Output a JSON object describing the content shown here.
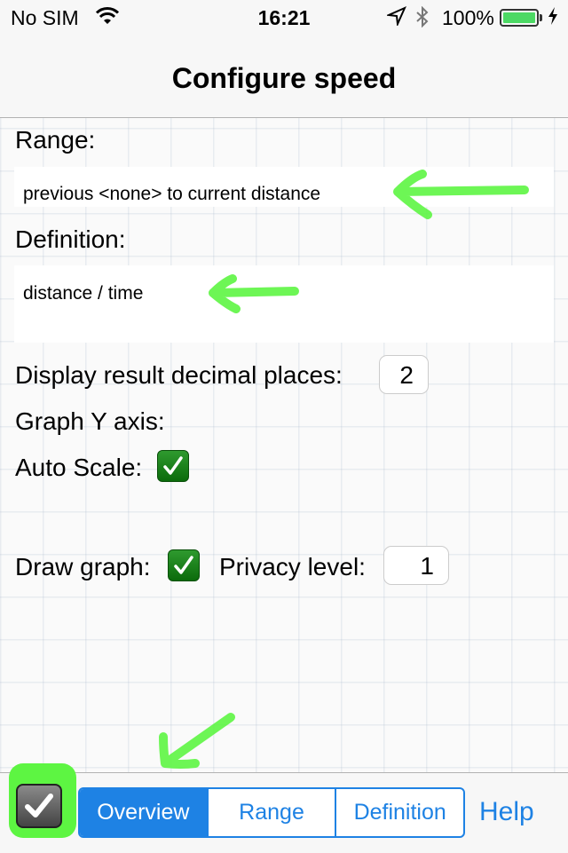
{
  "status_bar": {
    "carrier": "No SIM",
    "time": "16:21",
    "battery": "100%",
    "battery_level": 1.0,
    "icons": [
      "wifi-icon",
      "location-icon",
      "bluetooth-icon",
      "battery-icon",
      "charging-icon"
    ]
  },
  "nav": {
    "title": "Configure speed"
  },
  "form": {
    "range_label": "Range:",
    "range_value": "previous <none> to current distance",
    "definition_label": "Definition:",
    "definition_value": "distance / time",
    "decimal_label": "Display result decimal places:",
    "decimal_value": "2",
    "graph_y_label": "Graph Y axis:",
    "auto_scale_label": "Auto Scale:",
    "auto_scale_checked": true,
    "draw_graph_label": "Draw graph:",
    "draw_graph_checked": true,
    "privacy_label": "Privacy level:",
    "privacy_value": "1"
  },
  "toolbar": {
    "tabs": [
      {
        "label": "Overview",
        "selected": true
      },
      {
        "label": "Range",
        "selected": false
      },
      {
        "label": "Definition",
        "selected": false
      }
    ],
    "help_label": "Help"
  },
  "colors": {
    "accent": "#1e82e4",
    "annotation_green": "#5df542",
    "checkbox_green": "#1a8a1a"
  }
}
